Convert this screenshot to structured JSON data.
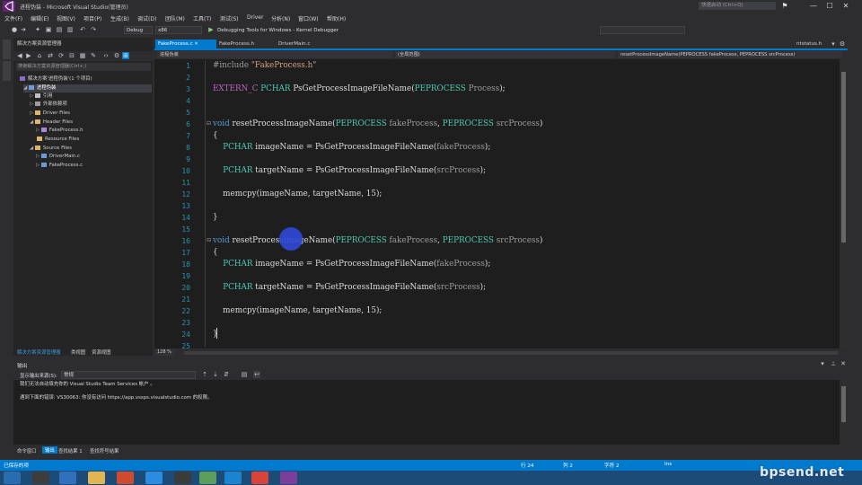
{
  "window": {
    "title": "进程伪装 - Microsoft Visual Studio(管理员)",
    "quick_launch_placeholder": "快速启动 (Ctrl+Q)",
    "minimize": "—",
    "maximize": "☐",
    "close": "✕"
  },
  "menu": [
    "文件(F)",
    "编辑(E)",
    "视图(V)",
    "项目(P)",
    "生成(B)",
    "调试(D)",
    "团队(M)",
    "工具(T)",
    "测试(S)",
    "Driver",
    "分析(N)",
    "窗口(W)",
    "帮助(H)"
  ],
  "toolbar": {
    "config": "Debug",
    "platform": "x86",
    "debugger_label": "Debugging Tools for Windows - Kernel Debugger",
    "run_glyph": "▶"
  },
  "solution_explorer": {
    "title": "解决方案资源管理器",
    "search_placeholder": "搜索解决方案资源管理器(Ctrl+;)",
    "items": [
      {
        "label": "解决方案'进程伪装'(1 个项目)",
        "depth": 0
      },
      {
        "label": "进程伪装",
        "depth": 1,
        "selected": true
      },
      {
        "label": "引用",
        "depth": 2
      },
      {
        "label": "外部依赖项",
        "depth": 2
      },
      {
        "label": "Driver Files",
        "depth": 2
      },
      {
        "label": "Header Files",
        "depth": 2
      },
      {
        "label": "FakeProcess.h",
        "depth": 3
      },
      {
        "label": "Resource Files",
        "depth": 2
      },
      {
        "label": "Source Files",
        "depth": 2
      },
      {
        "label": "DriverMain.c",
        "depth": 3
      },
      {
        "label": "FakeProcess.c",
        "depth": 3
      }
    ],
    "bottom_tabs": [
      "解决方案资源管理器",
      "类视图",
      "资源视图"
    ]
  },
  "editor": {
    "tabs": [
      {
        "label": "FakeProcess.c",
        "active": true
      },
      {
        "label": "FakeProcess.h",
        "active": false
      },
      {
        "label": "DriverMain.c",
        "active": false
      }
    ],
    "right_tab": "ntstatus.h",
    "nav": {
      "project": "进程伪装",
      "scope": "(全局范围)",
      "member": "resetProcessImageName(PEPROCESS fakeProcess, PEPROCESS srcProcess)"
    },
    "zoom": "128 %",
    "line_numbers": [
      "1",
      "2",
      "3",
      "4",
      "5",
      "6",
      "7",
      "8",
      "9",
      "10",
      "11",
      "12",
      "13",
      "14",
      "15",
      "16",
      "17",
      "18",
      "19",
      "20",
      "21",
      "22",
      "23",
      "24",
      "25"
    ],
    "lines": [
      "#include \"FakeProcess.h\"",
      "",
      "EXTERN_C PCHAR PsGetProcessImageFileName(PEPROCESS Process);",
      "",
      "",
      "void resetProcessImageName(PEPROCESS fakeProcess, PEPROCESS srcProcess)",
      "{",
      "    PCHAR imageName = PsGetProcessImageFileName(fakeProcess);",
      "",
      "    PCHAR targetName = PsGetProcessImageFileName(srcProcess);",
      "",
      "    memcpy(imageName, targetName, 15);",
      "",
      "}",
      "",
      "void resetProcessImageName(PEPROCESS fakeProcess, PEPROCESS srcProcess)",
      "{",
      "    PCHAR imageName = PsGetProcessImageFileName(fakeProcess);",
      "",
      "    PCHAR targetName = PsGetProcessImageFileName(srcProcess);",
      "",
      "    memcpy(imageName, targetName, 15);",
      "",
      "}",
      ""
    ]
  },
  "output": {
    "title": "输出",
    "show_from_label": "显示输出来源(S):",
    "show_from_value": "常规",
    "lines": [
      "我们无法自动填充你的 Visual Studio Team Services 帐户 。",
      "遇到下面的错误: VS30063: 你没有访问 https://app.vssps.visualstudio.com 的权限。"
    ],
    "bottom_tabs": [
      "命令窗口",
      "输出",
      "查找结果 1",
      "查找符号结果"
    ]
  },
  "status": {
    "left": "已保存的项",
    "line": "行 24",
    "col": "列 2",
    "ch": "字符 2",
    "mode": "Ins"
  },
  "watermark": "bpsend.net",
  "colors": {
    "accent": "#007acc",
    "editor_bg": "#1e1e1e",
    "keyword": "#569cd6",
    "type": "#4ec9b0",
    "string": "#d69d85"
  }
}
